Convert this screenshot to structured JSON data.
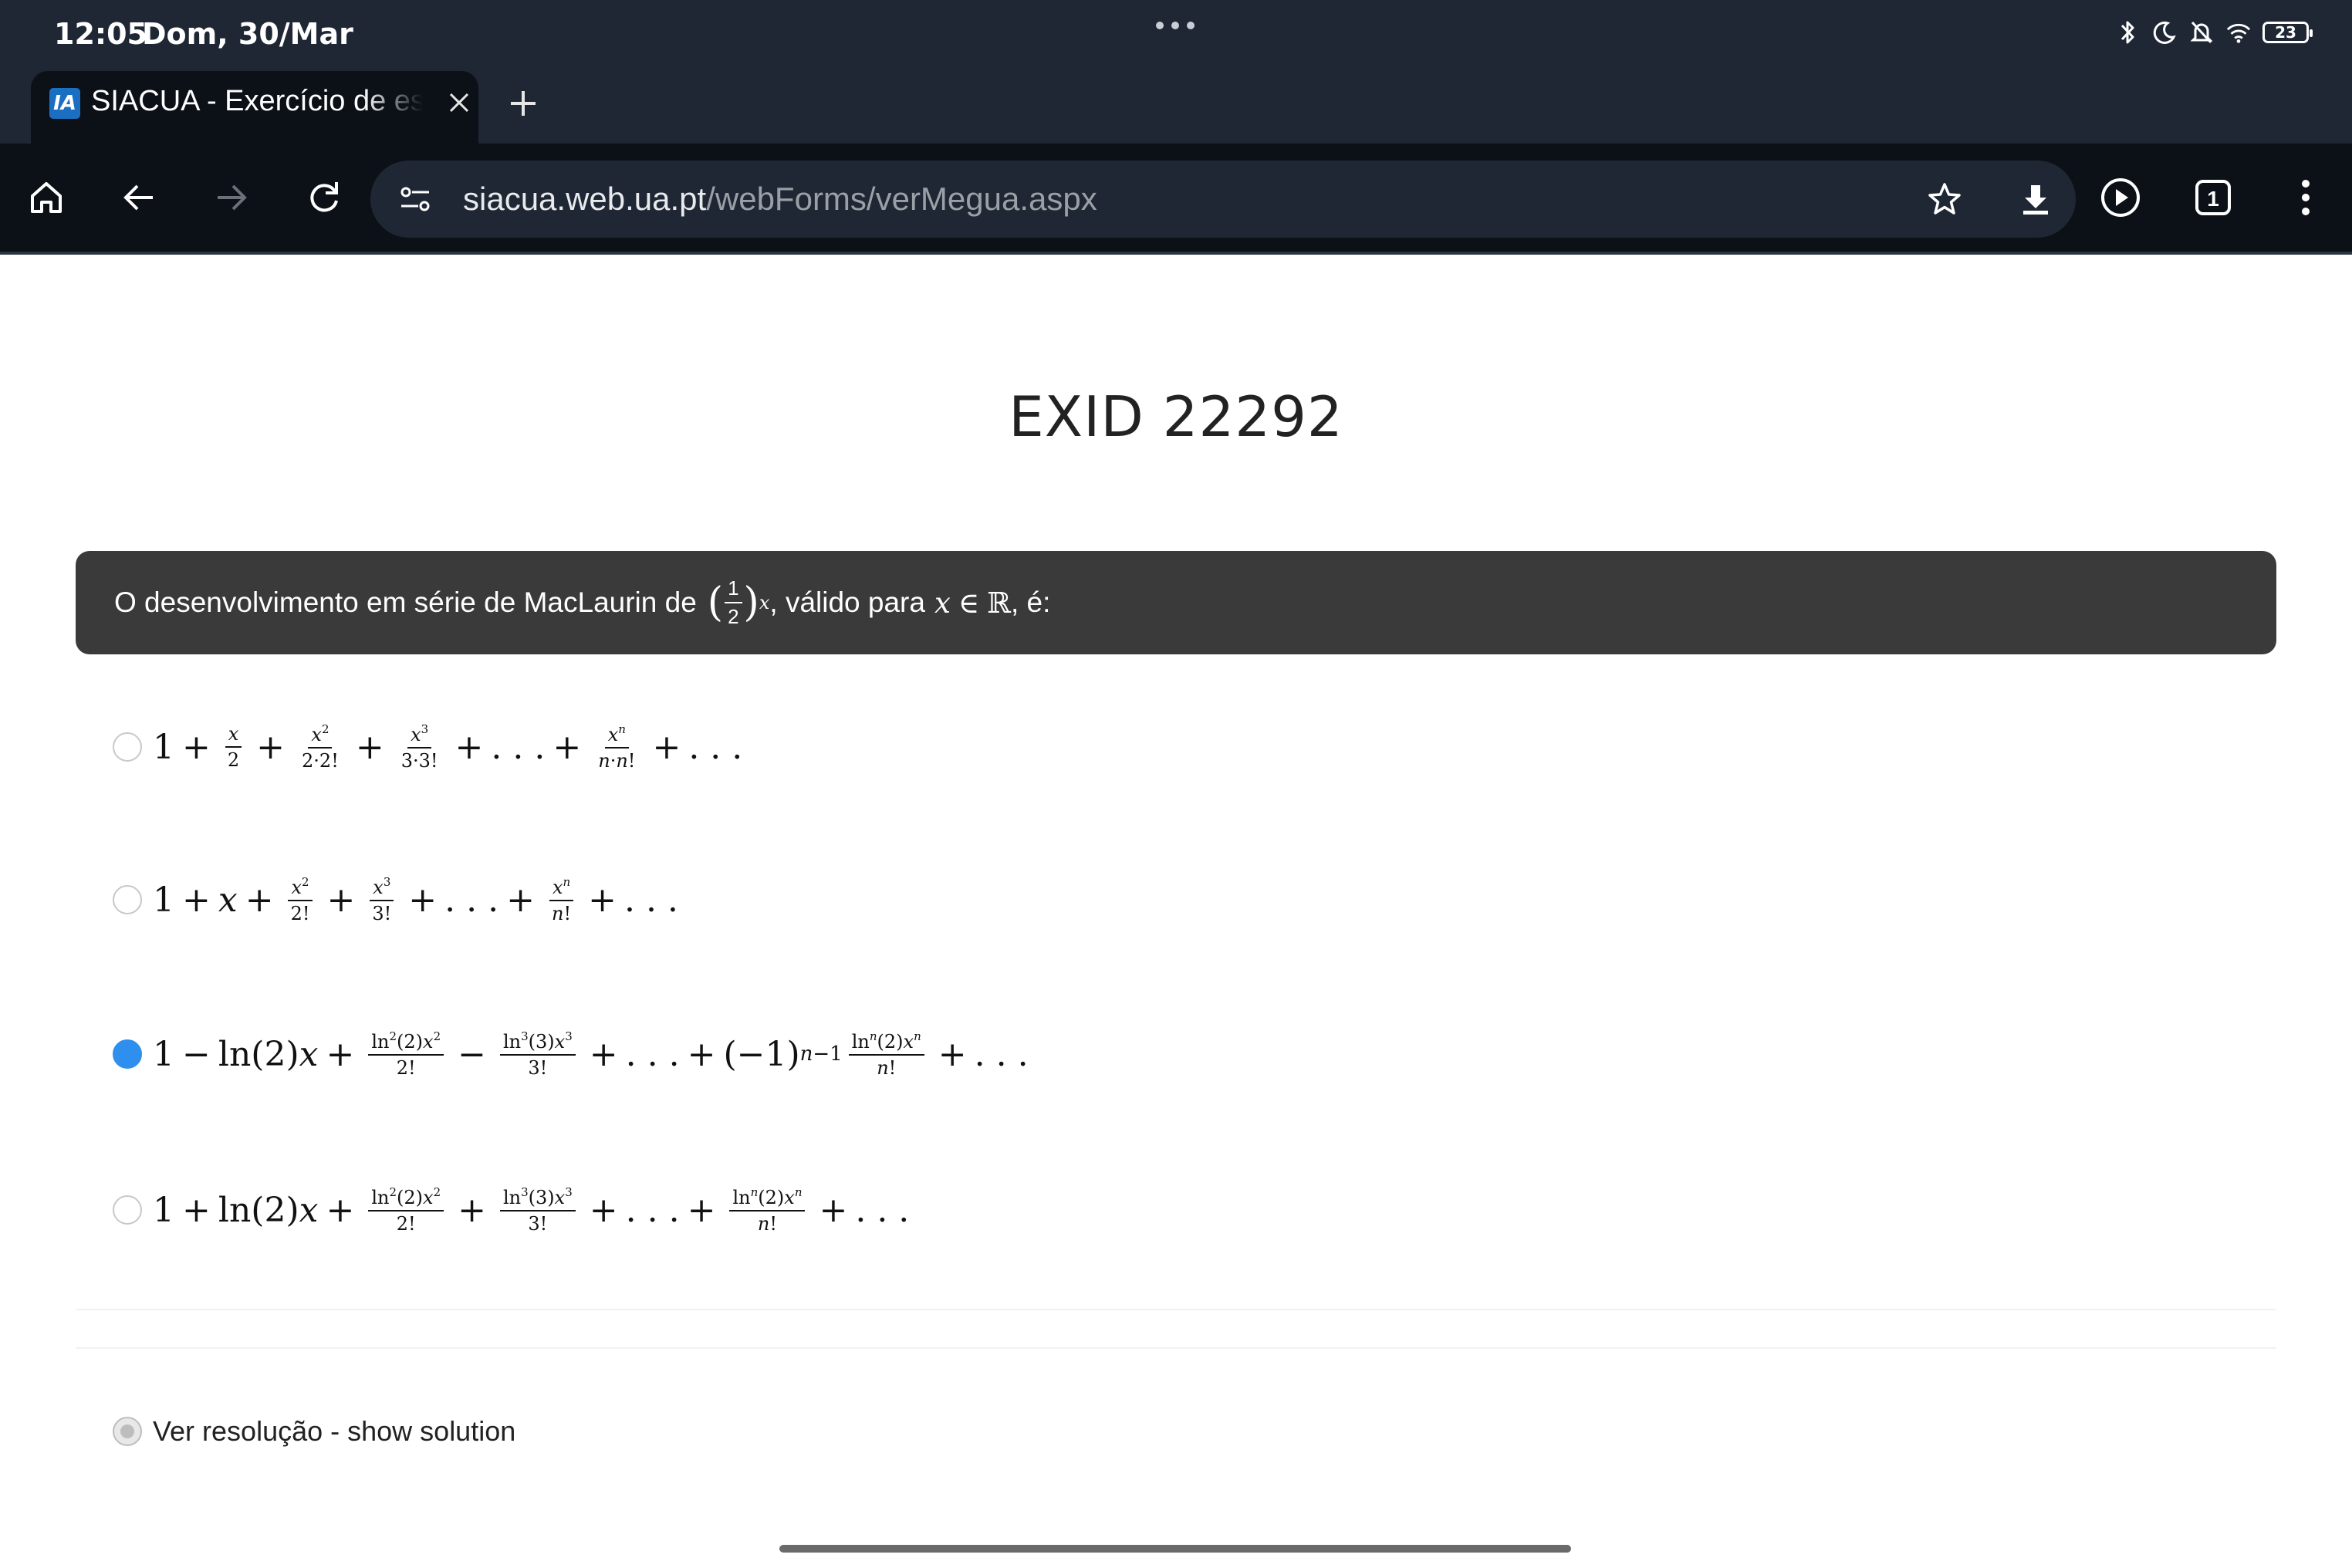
{
  "status_bar": {
    "time": "12:05",
    "date": "Dom, 30/Mar",
    "battery": "23"
  },
  "tab": {
    "favicon": "IA",
    "title": "SIACUA - Exercício de escolha",
    "close_icon": "close-icon"
  },
  "toolbar": {
    "url_domain": "siacua.web.ua.pt",
    "url_path": "/webForms/verMegua.aspx",
    "tab_count": "1"
  },
  "page": {
    "title": "EXID 22292",
    "question": {
      "prefix": "O desenvolvimento em série de MacLaurin de",
      "middle": ", válido para",
      "suffix": ", é:"
    },
    "options": [
      {
        "selected": false,
        "text": "1 + x/2 + x^2/(2·2!) + x^3/(3·3!) + ... + x^n/(n·n!) + ..."
      },
      {
        "selected": false,
        "text": "1 + x + x^2/2! + x^3/3! + ... + x^n/n! + ..."
      },
      {
        "selected": true,
        "text": "1 − ln(2)x + ln^2(2)x^2/2! − ln^3(3)x^3/3! + ... + (−1)^(n−1) ln^n(2)x^n/n! + ..."
      },
      {
        "selected": false,
        "text": "1 + ln(2)x + ln^2(2)x^2/2! + ln^3(3)x^3/3! + ... + ln^n(2)x^n/n! + ..."
      }
    ],
    "solution_label": "Ver resolução - show solution"
  },
  "colors": {
    "chrome": "#1f2734",
    "toolbar": "#0c1118",
    "question_bg": "#3a3a3a",
    "radio_checked": "#2f8fee"
  }
}
